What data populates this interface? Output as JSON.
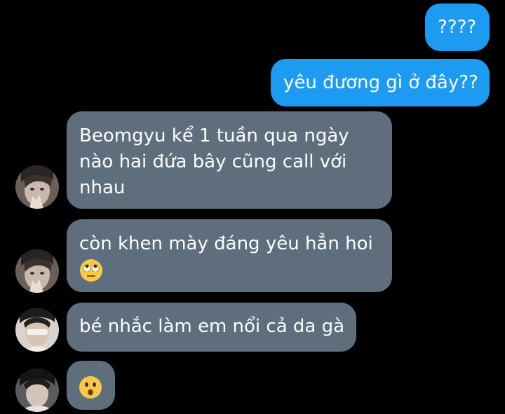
{
  "messages": [
    {
      "id": "m1",
      "direction": "sent",
      "text": "????"
    },
    {
      "id": "m2",
      "direction": "sent",
      "text": "yêu đương gì ở đây??"
    },
    {
      "id": "m3",
      "direction": "received",
      "text": "Beomgyu kể 1 tuần qua ngày\nnào hai đứa bây cũng call với\nnhau"
    },
    {
      "id": "m4",
      "direction": "received",
      "text": "còn khen mày đáng yêu hẳn hoi",
      "emoji": "face-with-rolling-eyes-icon"
    },
    {
      "id": "m5",
      "direction": "received",
      "text": "bé nhắc làm em nổi cả da gà"
    },
    {
      "id": "m6",
      "direction": "received",
      "emoji": "face-with-open-mouth-icon"
    }
  ],
  "colors": {
    "background": "#000000",
    "sent_bubble": "#1d9bf0",
    "received_bubble": "#5f6e7d",
    "text": "#ffffff"
  }
}
